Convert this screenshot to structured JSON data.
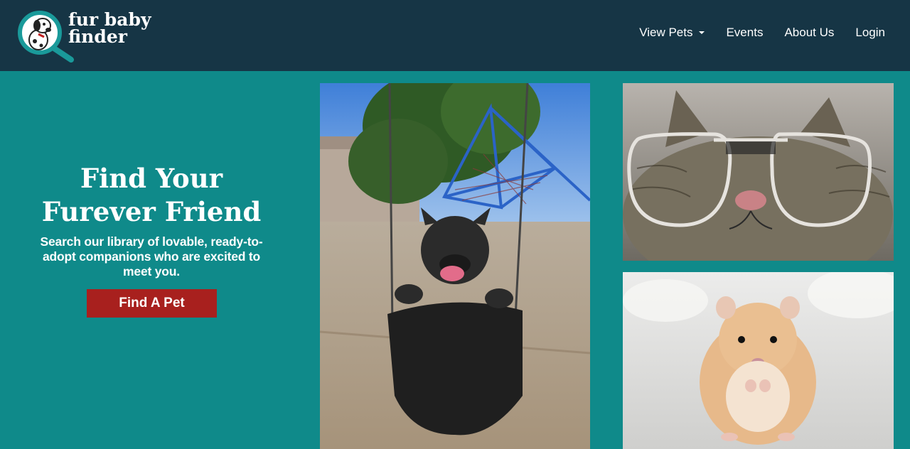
{
  "brand": {
    "name_line1": "fur baby",
    "name_line2": "finder"
  },
  "nav": {
    "view_pets": "View Pets",
    "events": "Events",
    "about": "About Us",
    "login": "Login"
  },
  "hero": {
    "title_line1": "Find Your",
    "title_line2": "Furever Friend",
    "subtitle": "Search our library of lovable, ready-to-adopt companions who are excited to meet you.",
    "cta_label": "Find A Pet"
  },
  "colors": {
    "nav_bg": "#163545",
    "page_bg": "#0f8a8a",
    "cta_bg": "#a8201e"
  }
}
